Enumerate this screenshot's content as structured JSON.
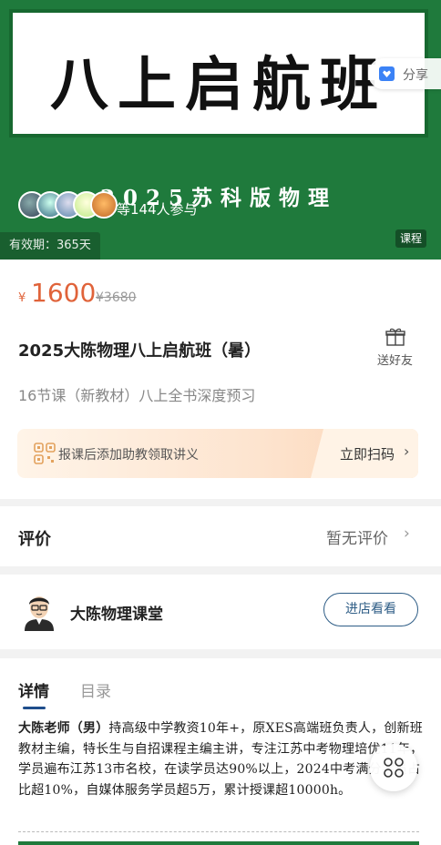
{
  "banner": {
    "title": "八上启航班",
    "subtitle": "2025苏科版物理",
    "participants": "等144人参与",
    "validity": "有效期：365天",
    "tag": "课程"
  },
  "share": {
    "label": "分享",
    "icon": "share-heart-icon"
  },
  "price": {
    "currency": "¥",
    "current": "1600",
    "original": "¥3680",
    "color": "#e0633a"
  },
  "course": {
    "title": "2025大陈物理八上启航班（暑）",
    "description": "16节课（新教材）八上全书深度预习",
    "gift_label": "送好友"
  },
  "promo": {
    "text": "报课后添加助教领取讲义",
    "button": "立即扫码",
    "chevron": "›"
  },
  "review": {
    "title": "评价",
    "value": "暂无评价",
    "chevron": "›"
  },
  "shop": {
    "name": "大陈物理课堂",
    "button": "进店看看"
  },
  "detail": {
    "tabs": [
      {
        "label": "详情",
        "active": true
      },
      {
        "label": "目录",
        "active": false
      }
    ],
    "teacher_name": "大陈老师（男）",
    "teacher_intro": "持高级中学教资10年+，原XES高端班负责人，创新班教材主编，特长生与自招课程主编主讲，专注江苏中考物理培优11年，学员遍布江苏13市名校，在读学员达90%以上，2024中考满分学员占比超10%，自媒体服务学员超5万，累计授课超10000h。"
  },
  "colors": {
    "brand_green": "#1f7a3c",
    "price_orange": "#e0633a",
    "shop_blue": "#2e5d86"
  }
}
